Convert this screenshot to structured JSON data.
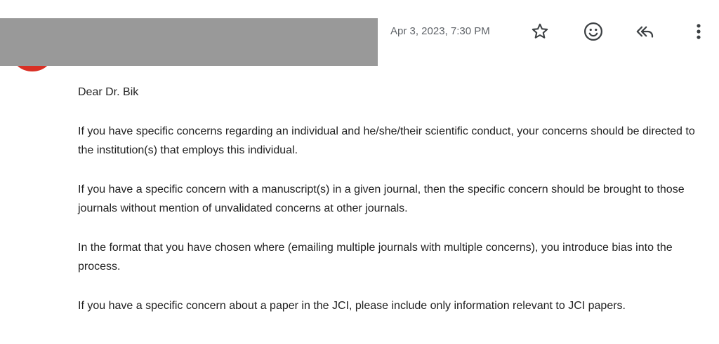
{
  "header": {
    "timestamp": "Apr 3, 2023, 7:30 PM",
    "icons": {
      "star": "star-icon",
      "emoji": "emoji-icon",
      "reply_all": "reply-all-icon",
      "more": "more-vert-icon"
    },
    "colors": {
      "redaction": "#999999",
      "avatar": "#d93025",
      "icon": "#3c4043"
    }
  },
  "message": {
    "greeting": "Dear Dr. Bik",
    "paragraphs": [
      "If you have specific concerns regarding an individual and he/she/their scientific conduct, your concerns should be directed to the institution(s) that employs this individual.",
      "If you have a specific concern with a manuscript(s) in a given journal, then the specific concern should be brought to those journals without mention of unvalidated concerns at other journals.",
      "In the format that you have chosen where (emailing multiple journals with multiple concerns), you introduce bias into the process.",
      "If you have a specific concern about a paper in the JCI, please include only information relevant to JCI papers."
    ]
  }
}
